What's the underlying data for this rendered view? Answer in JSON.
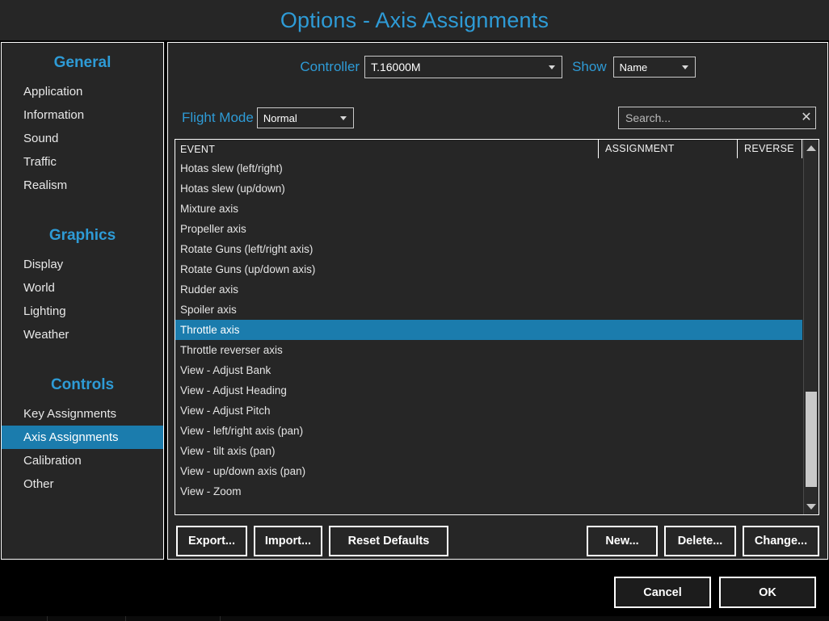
{
  "window": {
    "title": "Options - Axis Assignments",
    "accent_color": "#2e9bd6",
    "selection_color": "#1b7cad",
    "panel_bg": "#262626"
  },
  "sidebar": {
    "groups": [
      {
        "title": "General",
        "items": [
          {
            "label": "Application",
            "selected": false
          },
          {
            "label": "Information",
            "selected": false
          },
          {
            "label": "Sound",
            "selected": false
          },
          {
            "label": "Traffic",
            "selected": false
          },
          {
            "label": "Realism",
            "selected": false
          }
        ]
      },
      {
        "title": "Graphics",
        "items": [
          {
            "label": "Display",
            "selected": false
          },
          {
            "label": "World",
            "selected": false
          },
          {
            "label": "Lighting",
            "selected": false
          },
          {
            "label": "Weather",
            "selected": false
          }
        ]
      },
      {
        "title": "Controls",
        "items": [
          {
            "label": "Key Assignments",
            "selected": false
          },
          {
            "label": "Axis Assignments",
            "selected": true
          },
          {
            "label": "Calibration",
            "selected": false
          },
          {
            "label": "Other",
            "selected": false
          }
        ]
      }
    ]
  },
  "toolbar": {
    "controller_label": "Controller",
    "controller_value": "T.16000M",
    "show_label": "Show",
    "show_value": "Name",
    "flight_mode_label": "Flight Mode",
    "flight_mode_value": "Normal",
    "search_value": "",
    "search_placeholder": "Search...",
    "search_clear_glyph": "✕"
  },
  "list": {
    "columns": [
      "EVENT",
      "ASSIGNMENT",
      "REVERSE"
    ],
    "rows": [
      {
        "event": "Hotas slew (left/right)",
        "assignment": "",
        "reverse": "",
        "selected": false
      },
      {
        "event": "Hotas slew (up/down)",
        "assignment": "",
        "reverse": "",
        "selected": false
      },
      {
        "event": "Mixture axis",
        "assignment": "",
        "reverse": "",
        "selected": false
      },
      {
        "event": "Propeller axis",
        "assignment": "",
        "reverse": "",
        "selected": false
      },
      {
        "event": "Rotate Guns (left/right axis)",
        "assignment": "",
        "reverse": "",
        "selected": false
      },
      {
        "event": "Rotate Guns (up/down axis)",
        "assignment": "",
        "reverse": "",
        "selected": false
      },
      {
        "event": "Rudder axis",
        "assignment": "",
        "reverse": "",
        "selected": false
      },
      {
        "event": "Spoiler axis",
        "assignment": "",
        "reverse": "",
        "selected": false
      },
      {
        "event": "Throttle axis",
        "assignment": "",
        "reverse": "",
        "selected": true
      },
      {
        "event": "Throttle reverser axis",
        "assignment": "",
        "reverse": "",
        "selected": false
      },
      {
        "event": "View - Adjust Bank",
        "assignment": "",
        "reverse": "",
        "selected": false
      },
      {
        "event": "View - Adjust Heading",
        "assignment": "",
        "reverse": "",
        "selected": false
      },
      {
        "event": "View - Adjust Pitch",
        "assignment": "",
        "reverse": "",
        "selected": false
      },
      {
        "event": "View - left/right axis (pan)",
        "assignment": "",
        "reverse": "",
        "selected": false
      },
      {
        "event": "View - tilt axis (pan)",
        "assignment": "",
        "reverse": "",
        "selected": false
      },
      {
        "event": "View - up/down axis (pan)",
        "assignment": "",
        "reverse": "",
        "selected": false
      },
      {
        "event": "View - Zoom",
        "assignment": "",
        "reverse": "",
        "selected": false
      }
    ]
  },
  "actions": {
    "export": "Export...",
    "import": "Import...",
    "reset_defaults": "Reset Defaults",
    "new": "New...",
    "delete": "Delete...",
    "change": "Change..."
  },
  "footer": {
    "cancel": "Cancel",
    "ok": "OK"
  }
}
